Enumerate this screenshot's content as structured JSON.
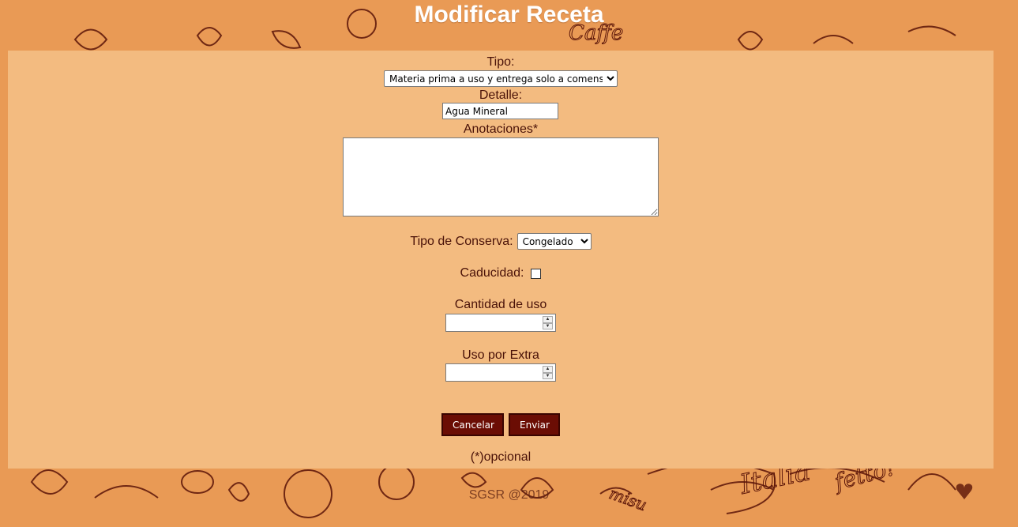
{
  "page": {
    "title": "Modificar Receta",
    "copyright": "SGSR @2019"
  },
  "form": {
    "tipo_label": "Tipo:",
    "tipo_value": "Materia prima a uso y entrega solo a comensal",
    "detalle_label": "Detalle:",
    "detalle_value": "Agua Mineral",
    "anotaciones_label": "Anotaciones*",
    "conserva_label": "Tipo de Conserva:",
    "conserva_value": "Congelado",
    "caducidad_label": "Caducidad:",
    "cantidad_label": "Cantidad de uso",
    "extra_label": "Uso por Extra",
    "cancel_label": "Cancelar",
    "submit_label": "Enviar",
    "optional_note": "(*)opcional"
  },
  "colors": {
    "background": "#e99a55",
    "panel": "#f3bb80",
    "button": "#6b0d04",
    "text": "#4a1208"
  }
}
